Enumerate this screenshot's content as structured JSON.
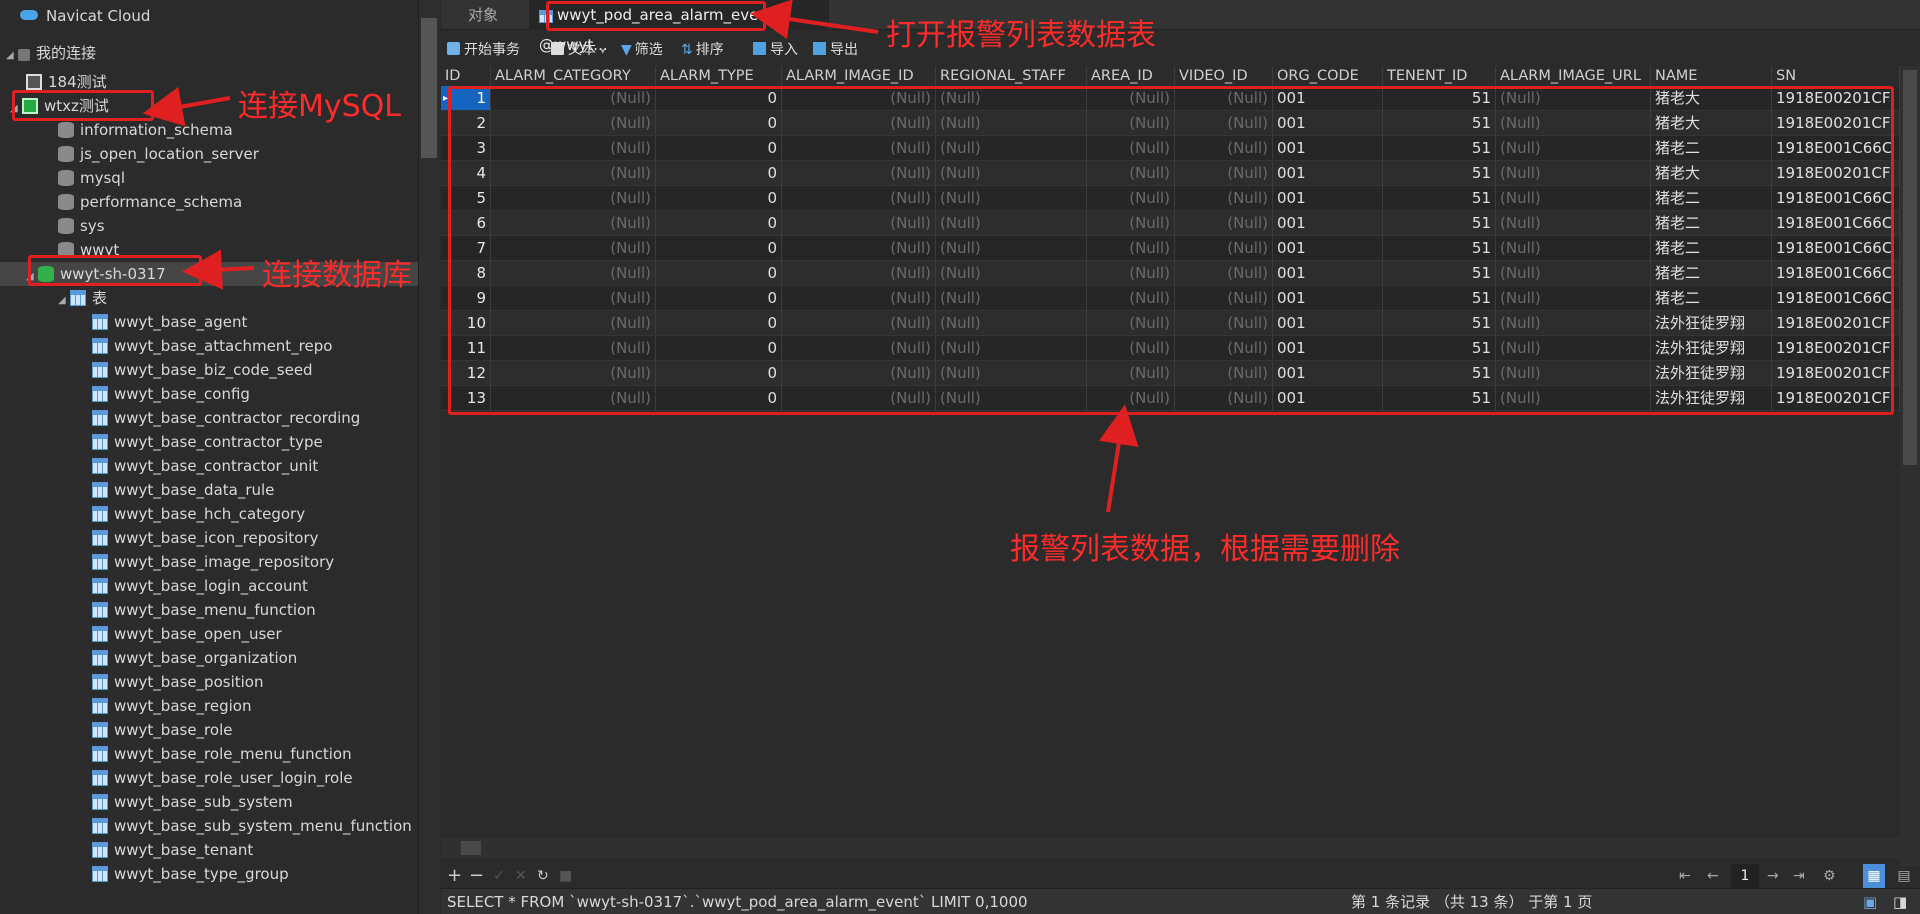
{
  "sidebar": {
    "cloud_label": "Navicat Cloud",
    "my_connections": "我的连接",
    "items": [
      {
        "label": "184测试",
        "kind": "conn",
        "level": 1
      },
      {
        "label": "wtxz测试",
        "kind": "conn-open",
        "level": 1
      },
      {
        "label": "information_schema",
        "kind": "db",
        "level": 2
      },
      {
        "label": "js_open_location_server",
        "kind": "db",
        "level": 2
      },
      {
        "label": "mysql",
        "kind": "db",
        "level": 2
      },
      {
        "label": "performance_schema",
        "kind": "db",
        "level": 2
      },
      {
        "label": "sys",
        "kind": "db",
        "level": 2
      },
      {
        "label": "wwyt",
        "kind": "db",
        "level": 2
      },
      {
        "label": "wwyt-sh-0317",
        "kind": "db-open",
        "level": 2
      },
      {
        "label": "表",
        "kind": "folder",
        "level": 3
      },
      {
        "label": "wwyt_base_agent",
        "kind": "table",
        "level": 4
      },
      {
        "label": "wwyt_base_attachment_repo",
        "kind": "table",
        "level": 4
      },
      {
        "label": "wwyt_base_biz_code_seed",
        "kind": "table",
        "level": 4
      },
      {
        "label": "wwyt_base_config",
        "kind": "table",
        "level": 4
      },
      {
        "label": "wwyt_base_contractor_recording",
        "kind": "table",
        "level": 4
      },
      {
        "label": "wwyt_base_contractor_type",
        "kind": "table",
        "level": 4
      },
      {
        "label": "wwyt_base_contractor_unit",
        "kind": "table",
        "level": 4
      },
      {
        "label": "wwyt_base_data_rule",
        "kind": "table",
        "level": 4
      },
      {
        "label": "wwyt_base_hch_category",
        "kind": "table",
        "level": 4
      },
      {
        "label": "wwyt_base_icon_repository",
        "kind": "table",
        "level": 4
      },
      {
        "label": "wwyt_base_image_repository",
        "kind": "table",
        "level": 4
      },
      {
        "label": "wwyt_base_login_account",
        "kind": "table",
        "level": 4
      },
      {
        "label": "wwyt_base_menu_function",
        "kind": "table",
        "level": 4
      },
      {
        "label": "wwyt_base_open_user",
        "kind": "table",
        "level": 4
      },
      {
        "label": "wwyt_base_organization",
        "kind": "table",
        "level": 4
      },
      {
        "label": "wwyt_base_position",
        "kind": "table",
        "level": 4
      },
      {
        "label": "wwyt_base_region",
        "kind": "table",
        "level": 4
      },
      {
        "label": "wwyt_base_role",
        "kind": "table",
        "level": 4
      },
      {
        "label": "wwyt_base_role_menu_function",
        "kind": "table",
        "level": 4
      },
      {
        "label": "wwyt_base_role_user_login_role",
        "kind": "table",
        "level": 4
      },
      {
        "label": "wwyt_base_sub_system",
        "kind": "table",
        "level": 4
      },
      {
        "label": "wwyt_base_sub_system_menu_function",
        "kind": "table",
        "level": 4
      },
      {
        "label": "wwyt_base_tenant",
        "kind": "table",
        "level": 4
      },
      {
        "label": "wwyt_base_type_group",
        "kind": "table",
        "level": 4
      }
    ]
  },
  "tabs": [
    {
      "label": "对象",
      "active": false
    },
    {
      "label": "wwyt_pod_area_alarm_event @wwyt...",
      "active": true
    }
  ],
  "toolbar": {
    "begin_transaction": "开始事务",
    "text": "文本",
    "filter": "筛选",
    "sort": "排序",
    "import": "导入",
    "export": "导出"
  },
  "grid": {
    "columns": [
      "ID",
      "ALARM_CATEGORY",
      "ALARM_TYPE",
      "ALARM_IMAGE_ID",
      "REGIONAL_STAFF",
      "AREA_ID",
      "VIDEO_ID",
      "ORG_CODE",
      "TENENT_ID",
      "ALARM_IMAGE_URL",
      "NAME",
      "SN"
    ],
    "null_text": "(Null)",
    "rows": [
      {
        "id": "1",
        "alarm_type": "0",
        "org_code": "001",
        "tenent_id": "51",
        "name": "猪老大",
        "sn": "1918E00201CF"
      },
      {
        "id": "2",
        "alarm_type": "0",
        "org_code": "001",
        "tenent_id": "51",
        "name": "猪老大",
        "sn": "1918E00201CF"
      },
      {
        "id": "3",
        "alarm_type": "0",
        "org_code": "001",
        "tenent_id": "51",
        "name": "猪老二",
        "sn": "1918E001C66C"
      },
      {
        "id": "4",
        "alarm_type": "0",
        "org_code": "001",
        "tenent_id": "51",
        "name": "猪老大",
        "sn": "1918E00201CF"
      },
      {
        "id": "5",
        "alarm_type": "0",
        "org_code": "001",
        "tenent_id": "51",
        "name": "猪老二",
        "sn": "1918E001C66C"
      },
      {
        "id": "6",
        "alarm_type": "0",
        "org_code": "001",
        "tenent_id": "51",
        "name": "猪老二",
        "sn": "1918E001C66C"
      },
      {
        "id": "7",
        "alarm_type": "0",
        "org_code": "001",
        "tenent_id": "51",
        "name": "猪老二",
        "sn": "1918E001C66C"
      },
      {
        "id": "8",
        "alarm_type": "0",
        "org_code": "001",
        "tenent_id": "51",
        "name": "猪老二",
        "sn": "1918E001C66C"
      },
      {
        "id": "9",
        "alarm_type": "0",
        "org_code": "001",
        "tenent_id": "51",
        "name": "猪老二",
        "sn": "1918E001C66C"
      },
      {
        "id": "10",
        "alarm_type": "0",
        "org_code": "001",
        "tenent_id": "51",
        "name": "法外狂徒罗翔",
        "sn": "1918E00201CF"
      },
      {
        "id": "11",
        "alarm_type": "0",
        "org_code": "001",
        "tenent_id": "51",
        "name": "法外狂徒罗翔",
        "sn": "1918E00201CF"
      },
      {
        "id": "12",
        "alarm_type": "0",
        "org_code": "001",
        "tenent_id": "51",
        "name": "法外狂徒罗翔",
        "sn": "1918E00201CF"
      },
      {
        "id": "13",
        "alarm_type": "0",
        "org_code": "001",
        "tenent_id": "51",
        "name": "法外狂徒罗翔",
        "sn": "1918E00201CF"
      }
    ]
  },
  "pager": {
    "page": "1"
  },
  "status": {
    "sql": "SELECT * FROM `wwyt-sh-0317`.`wwyt_pod_area_alarm_event` LIMIT 0,1000",
    "record_info": "第 1 条记录 （共 13 条） 于第 1 页"
  },
  "annotations": {
    "open_table": "打开报警列表数据表",
    "connect_mysql": "连接MySQL",
    "connect_db": "连接数据库",
    "delete_hint": "报警列表数据，根据需要删除"
  },
  "colors": {
    "annotation": "#e02020",
    "selected_cell": "#1565c0"
  }
}
